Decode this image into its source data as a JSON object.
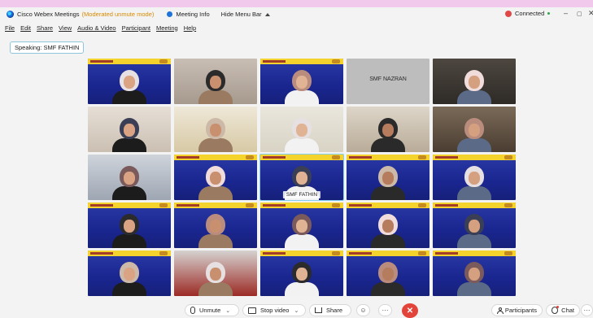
{
  "window": {
    "app_title": "Cisco Webex Meetings",
    "mode": "(Moderated unmute mode)",
    "meeting_info": "Meeting Info",
    "hide_menu": "Hide Menu Bar",
    "status": "Connected",
    "controls": [
      "–",
      "▢",
      "✕"
    ]
  },
  "menu": [
    "File",
    "Edit",
    "Share",
    "View",
    "Audio & Video",
    "Participant",
    "Meeting",
    "Help"
  ],
  "speaking": "Speaking: SMF FATHIN",
  "tiles": [
    {
      "style": "blue",
      "banner": true,
      "name": ""
    },
    {
      "style": "bg-room1",
      "banner": false,
      "name": ""
    },
    {
      "style": "blue",
      "banner": true,
      "name": ""
    },
    {
      "style": "name-only",
      "banner": false,
      "name": "SMF NAZRAN"
    },
    {
      "style": "bg-room7",
      "banner": false,
      "name": ""
    },
    {
      "style": "bg-room2",
      "banner": false,
      "name": ""
    },
    {
      "style": "bg-room6",
      "banner": false,
      "name": ""
    },
    {
      "style": "bg-room3",
      "banner": false,
      "name": ""
    },
    {
      "style": "bg-room5",
      "banner": false,
      "name": ""
    },
    {
      "style": "bg-room4",
      "banner": false,
      "name": ""
    },
    {
      "style": "bg-snow",
      "banner": false,
      "name": ""
    },
    {
      "style": "blue",
      "banner": true,
      "name": ""
    },
    {
      "style": "blue",
      "banner": true,
      "name": "SMF FATHIN",
      "active": true
    },
    {
      "style": "blue",
      "banner": true,
      "name": ""
    },
    {
      "style": "blue",
      "banner": true,
      "name": ""
    },
    {
      "style": "blue",
      "banner": true,
      "name": ""
    },
    {
      "style": "blue",
      "banner": true,
      "name": ""
    },
    {
      "style": "blue",
      "banner": true,
      "name": ""
    },
    {
      "style": "blue",
      "banner": true,
      "name": ""
    },
    {
      "style": "blue",
      "banner": true,
      "name": ""
    },
    {
      "style": "blue",
      "banner": true,
      "name": ""
    },
    {
      "style": "bg-red",
      "banner": false,
      "name": ""
    },
    {
      "style": "blue",
      "banner": true,
      "name": ""
    },
    {
      "style": "blue",
      "banner": true,
      "name": ""
    },
    {
      "style": "blue",
      "banner": true,
      "name": ""
    }
  ],
  "toolbar": {
    "unmute": "Unmute",
    "stop_video": "Stop video",
    "share": "Share",
    "participants": "Participants",
    "chat": "Chat",
    "more": "···",
    "leave_icon": "close-icon"
  }
}
